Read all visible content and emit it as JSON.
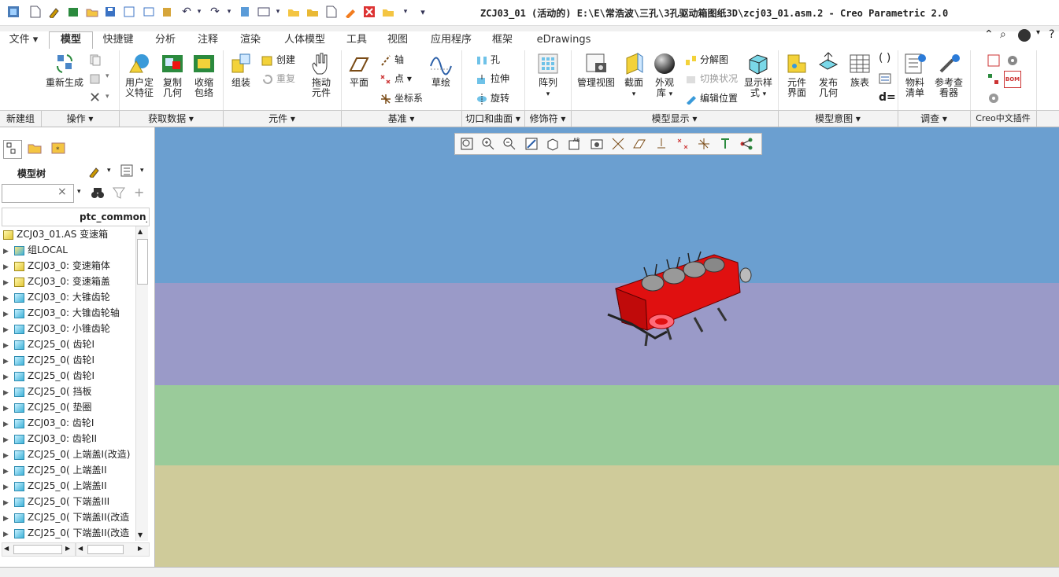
{
  "window": {
    "title": "ZCJ03_01 (活动的) E:\\E\\常浩波\\三孔\\3孔驱动箱图纸3D\\zcj03_01.asm.2 - Creo Parametric 2.0"
  },
  "tabs": [
    {
      "label": "文件 ▾"
    },
    {
      "label": "模型"
    },
    {
      "label": "快捷键"
    },
    {
      "label": "分析"
    },
    {
      "label": "注释"
    },
    {
      "label": "渲染"
    },
    {
      "label": "人体模型"
    },
    {
      "label": "工具"
    },
    {
      "label": "视图"
    },
    {
      "label": "应用程序"
    },
    {
      "label": "框架"
    },
    {
      "label": "eDrawings"
    }
  ],
  "ribbon": {
    "regenerate": "重新生成",
    "udf": [
      "用户定",
      "义特征"
    ],
    "copy_geom": [
      "复制",
      "几何"
    ],
    "shrinkwrap": [
      "收缩",
      "包络"
    ],
    "assemble": "组装",
    "create": "创建",
    "repeat": "重复",
    "drag": [
      "拖动",
      "元件"
    ],
    "plane": "平面",
    "axis": "轴",
    "point": "点",
    "csys": "坐标系",
    "sketch": "草绘",
    "hole": "孔",
    "extrude": "拉伸",
    "revolve": "旋转",
    "pattern": "阵列",
    "manage_views": "管理视图",
    "section": "截面",
    "appearance": [
      "外观",
      "库"
    ],
    "explode": "分解图",
    "toggle_state": "切换状况",
    "edit_position": "编辑位置",
    "display_style": [
      "显示样",
      "式"
    ],
    "comp_interface": [
      "元件",
      "界面"
    ],
    "publish_geom": [
      "发布",
      "几何"
    ],
    "family_table": "族表",
    "bom": [
      "物料",
      "清单"
    ],
    "ref_viewer": [
      "参考查",
      "看器"
    ]
  },
  "groups": [
    {
      "label": "新建组"
    },
    {
      "label": "操作 ▾"
    },
    {
      "label": "获取数据 ▾"
    },
    {
      "label": "元件 ▾"
    },
    {
      "label": "基准 ▾"
    },
    {
      "label": "切口和曲面 ▾"
    },
    {
      "label": "修饰符 ▾"
    },
    {
      "label": "模型显示 ▾"
    },
    {
      "label": "模型意图 ▾"
    },
    {
      "label": "调查 ▾"
    },
    {
      "label": "Creo中文插件"
    }
  ],
  "tree": {
    "title": "模型树",
    "column_header": "ptc_common_n",
    "search_value": "",
    "rows": [
      {
        "label": "ZCJ03_01.AS 变速箱",
        "kind": "asm"
      },
      {
        "label": "组LOCAL",
        "kind": "group"
      },
      {
        "label": "ZCJ03_0: 变速箱体",
        "kind": "asm"
      },
      {
        "label": "ZCJ03_0: 变速箱盖",
        "kind": "asm"
      },
      {
        "label": "ZCJ03_0: 大锥齿轮",
        "kind": "part"
      },
      {
        "label": "ZCJ03_0: 大锥齿轮轴",
        "kind": "part"
      },
      {
        "label": "ZCJ03_0: 小锥齿轮",
        "kind": "part"
      },
      {
        "label": "ZCJ25_0( 齿轮I",
        "kind": "part"
      },
      {
        "label": "ZCJ25_0( 齿轮I",
        "kind": "part"
      },
      {
        "label": "ZCJ25_0( 齿轮I",
        "kind": "part"
      },
      {
        "label": "ZCJ25_0( 挡板",
        "kind": "part"
      },
      {
        "label": "ZCJ25_0( 垫圈",
        "kind": "part"
      },
      {
        "label": "ZCJ03_0: 齿轮I",
        "kind": "part"
      },
      {
        "label": "ZCJ03_0: 齿轮II",
        "kind": "part"
      },
      {
        "label": "ZCJ25_0( 上端盖I(改造)",
        "kind": "part"
      },
      {
        "label": "ZCJ25_0( 上端盖II",
        "kind": "part"
      },
      {
        "label": "ZCJ25_0( 上端盖II",
        "kind": "part"
      },
      {
        "label": "ZCJ25_0( 下端盖III",
        "kind": "part"
      },
      {
        "label": "ZCJ25_0( 下端盖II(改造",
        "kind": "part"
      },
      {
        "label": "ZCJ25_0( 下端盖II(改造",
        "kind": "part"
      }
    ]
  },
  "viewport": {
    "band_colors": [
      "#6b9fd0",
      "#9a9ac8",
      "#9acb9a",
      "#cfcb9a"
    ],
    "model_color": "#e01010"
  }
}
